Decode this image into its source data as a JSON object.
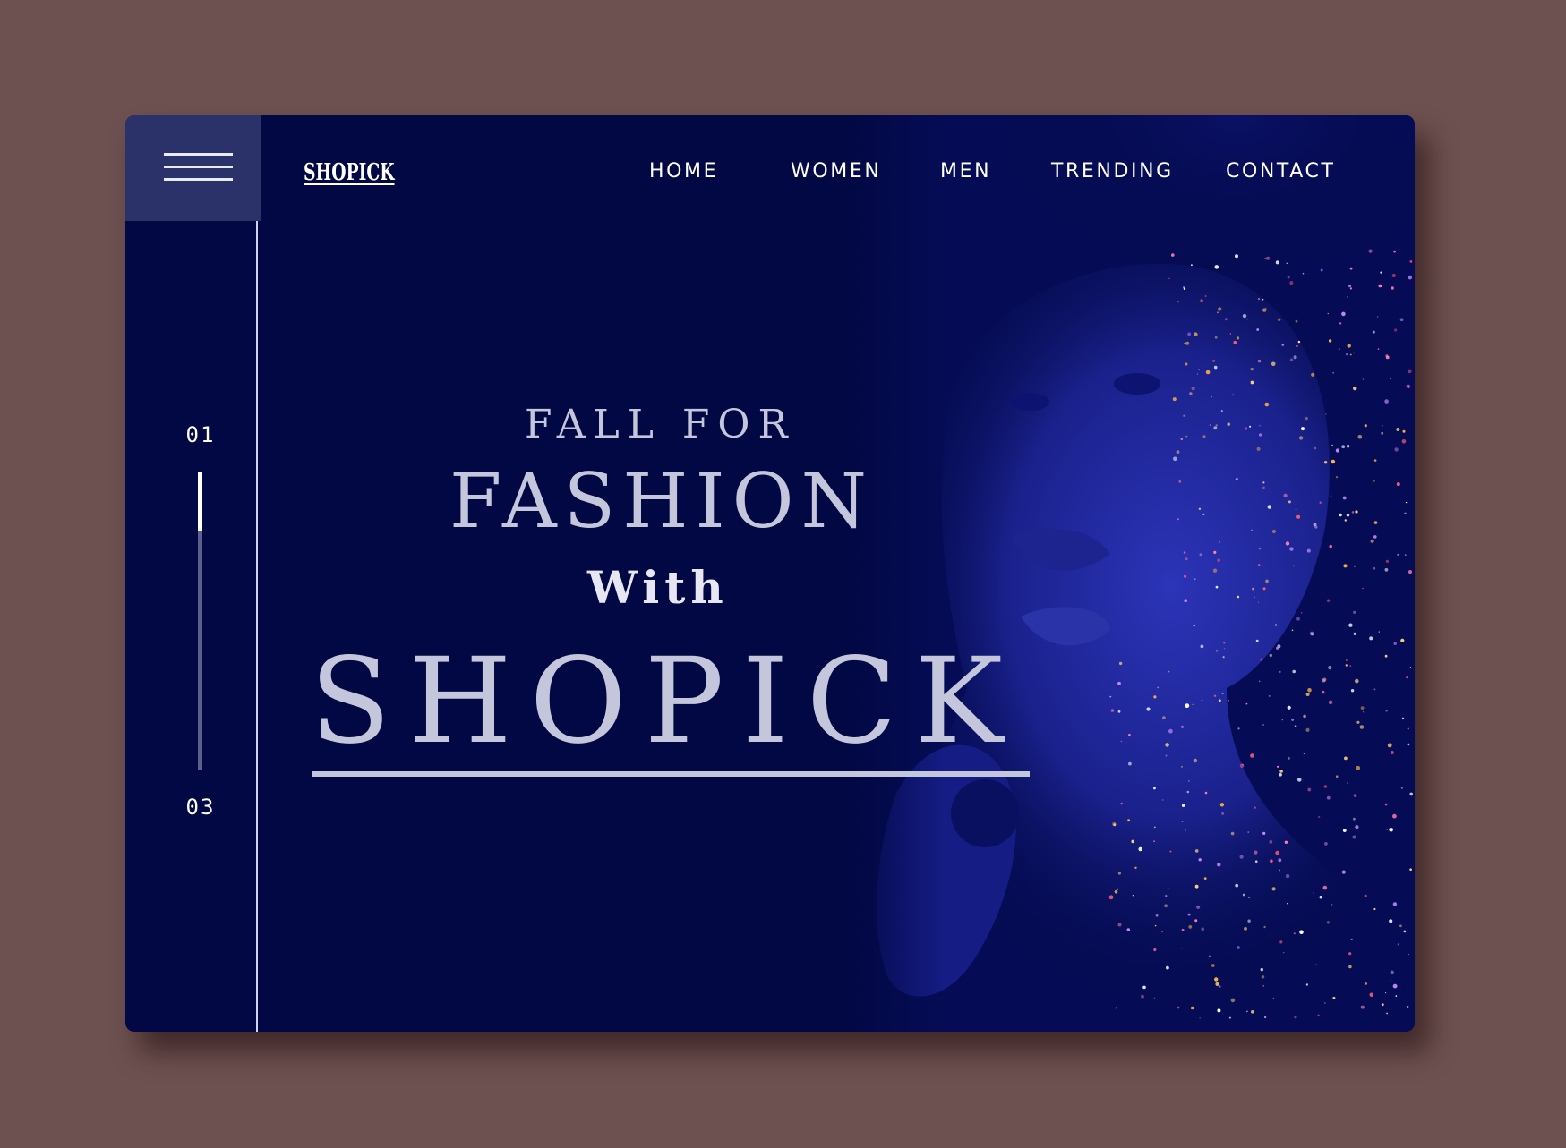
{
  "brand": {
    "name": "SHOPICK"
  },
  "nav": {
    "items": [
      {
        "label": "HOME"
      },
      {
        "label": "WOMEN"
      },
      {
        "label": "MEN"
      },
      {
        "label": "TRENDING"
      },
      {
        "label": "CONTACT"
      }
    ]
  },
  "menu": {
    "icon": "hamburger-menu-icon"
  },
  "slider": {
    "current_label": "01",
    "total_label": "03",
    "progress": 0.2
  },
  "hero": {
    "line1": "FALL FOR",
    "line2": "FASHION",
    "line3": "With",
    "line4": "SHOPICK",
    "image": "portrait-glitter-face"
  },
  "colors": {
    "background": "#6d5050",
    "frame": "#020843",
    "menu_button": "#2b3269",
    "text_primary": "#ffffff",
    "hero_text": "#c4c7dc"
  }
}
